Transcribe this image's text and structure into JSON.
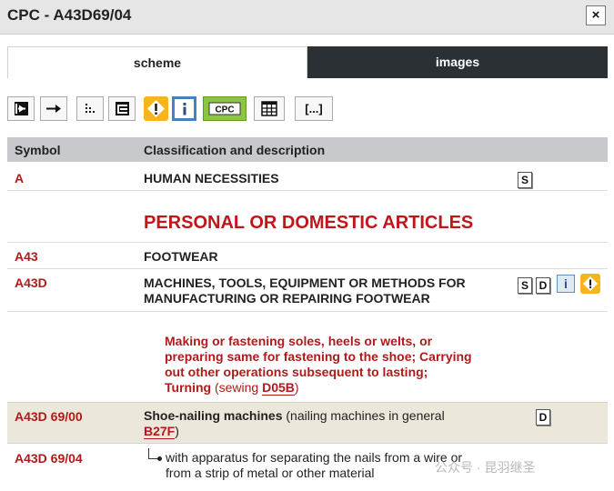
{
  "window": {
    "title": "CPC - A43D69/04",
    "close_glyph": "×"
  },
  "tabs": [
    {
      "label": "scheme",
      "active": true
    },
    {
      "label": "images",
      "active": false
    }
  ],
  "toolbar": {
    "buttons": [
      {
        "name": "collapse-left-icon"
      },
      {
        "name": "arrow-right-icon"
      },
      {
        "name": "hierarchy-icon"
      },
      {
        "name": "expand-box-icon"
      },
      {
        "name": "warning-icon"
      },
      {
        "name": "info-icon"
      },
      {
        "name": "cpc-icon",
        "label": "CPC"
      },
      {
        "name": "table-icon"
      },
      {
        "name": "ellipsis-icon",
        "label": "[...]"
      }
    ]
  },
  "table": {
    "headers": {
      "symbol": "Symbol",
      "description": "Classification and description"
    },
    "rows": [
      {
        "symbol": "A",
        "description": "HUMAN NECESSITIES",
        "icons": [
          "S"
        ]
      },
      {
        "section_heading": "PERSONAL OR DOMESTIC ARTICLES"
      },
      {
        "symbol": "A43",
        "description": "FOOTWEAR"
      },
      {
        "symbol": "A43D",
        "description_line1": "MACHINES, TOOLS, EQUIPMENT OR METHODS FOR",
        "description_line2": "MANUFACTURING OR REPAIRING FOOTWEAR",
        "icons": [
          "S",
          "D",
          "i",
          "!"
        ]
      }
    ],
    "note": {
      "line1": "Making or fastening soles, heels or welts, or",
      "line2": "preparing same for fastening to the shoe; Carrying",
      "line3": "out other operations subsequent to lasting;",
      "line4_bold": "Turning",
      "line4_paren_open": " (sewing ",
      "line4_link": "D05B",
      "line4_paren_close": ")"
    },
    "highlighted_row": {
      "symbol": "A43D 69/00",
      "bold": "Shoe-nailing machines",
      "rest": " (nailing machines in general",
      "link": "B27F",
      "close": ")",
      "icon": "D"
    },
    "last_row": {
      "symbol": "A43D 69/04",
      "line1": "with apparatus for separating the nails from a wire or",
      "line2": "from a strip of metal or other material"
    }
  },
  "colors": {
    "accent_red": "#b01a1a",
    "tab_dark": "#2b3035",
    "header_gray": "#c7c9cc",
    "highlight": "#ebe7da"
  },
  "watermark": "公众号 · 昆羽继圣"
}
